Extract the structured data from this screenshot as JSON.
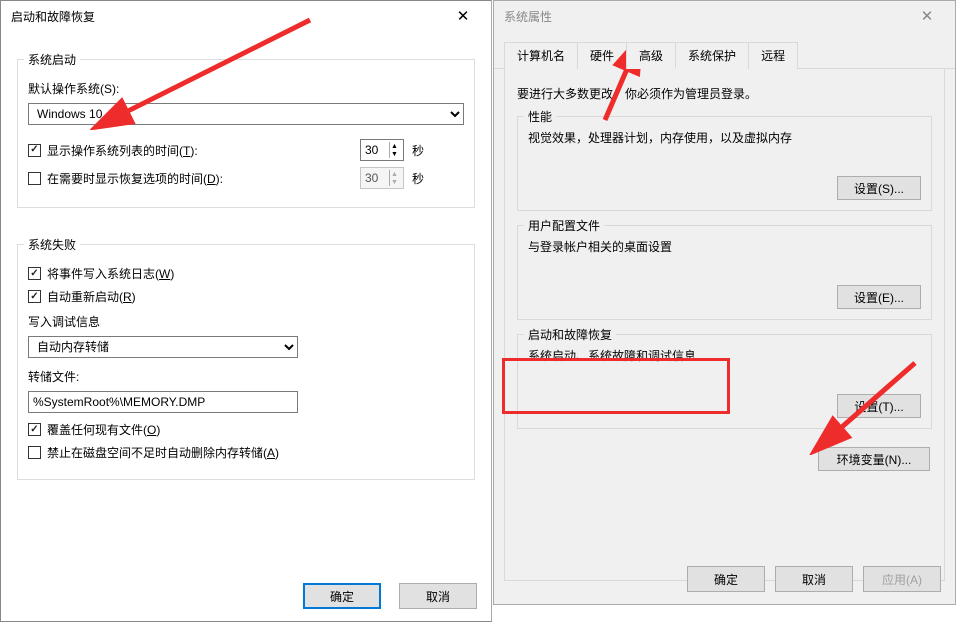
{
  "left": {
    "title": "启动和故障恢复",
    "group_startup": {
      "label": "系统启动",
      "default_os_label": "默认操作系统(S):",
      "default_os_value": "Windows 10",
      "show_list_checked": true,
      "show_list_label_a": "显示操作系统列表的时间(",
      "show_list_label_u": "T",
      "show_list_label_b": "):",
      "show_list_seconds": "30",
      "show_recovery_checked": false,
      "show_recovery_label_a": "在需要时显示恢复选项的时间(",
      "show_recovery_label_u": "D",
      "show_recovery_label_b": "):",
      "show_recovery_seconds": "30",
      "seconds_unit": "秒"
    },
    "group_failure": {
      "label": "系统失败",
      "write_event_checked": true,
      "write_event_label_a": "将事件写入系统日志(",
      "write_event_label_u": "W",
      "write_event_label_b": ")",
      "auto_restart_checked": true,
      "auto_restart_label_a": "自动重新启动(",
      "auto_restart_label_u": "R",
      "auto_restart_label_b": ")",
      "debug_info_label": "写入调试信息",
      "debug_select_value": "自动内存转储",
      "dump_file_label": "转储文件:",
      "dump_file_value": "%SystemRoot%\\MEMORY.DMP",
      "overwrite_checked": true,
      "overwrite_label_a": "覆盖任何现有文件(",
      "overwrite_label_u": "O",
      "overwrite_label_b": ")",
      "no_dump_low_space_checked": false,
      "no_dump_low_space_label_a": "禁止在磁盘空间不足时自动删除内存转储(",
      "no_dump_low_space_label_u": "A",
      "no_dump_low_space_label_b": ")"
    },
    "ok": "确定",
    "cancel": "取消"
  },
  "right": {
    "title": "系统属性",
    "tabs": [
      "计算机名",
      "硬件",
      "高级",
      "系统保护",
      "远程"
    ],
    "active_tab": 2,
    "admin_text": "要进行大多数更改，你必须作为管理员登录。",
    "perf": {
      "title": "性能",
      "desc": "视觉效果，处理器计划，内存使用，以及虚拟内存",
      "btn": "设置(S)..."
    },
    "profiles": {
      "title": "用户配置文件",
      "desc": "与登录帐户相关的桌面设置",
      "btn": "设置(E)..."
    },
    "startup": {
      "title": "启动和故障恢复",
      "desc": "系统启动、系统故障和调试信息",
      "btn": "设置(T)..."
    },
    "env_btn": "环境变量(N)...",
    "ok": "确定",
    "cancel": "取消",
    "apply": "应用(A)"
  }
}
